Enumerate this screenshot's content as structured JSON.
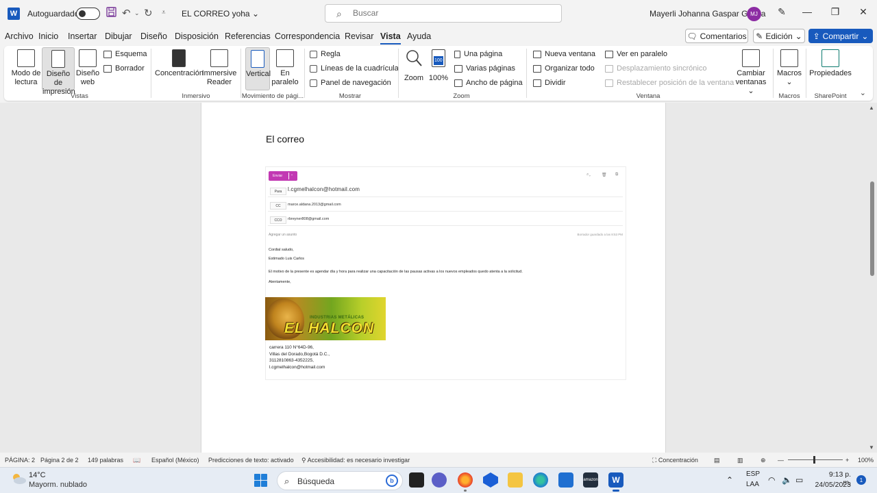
{
  "titlebar": {
    "autosave_label": "Autoguardado",
    "doc_title": "EL  CORREO yoha",
    "search_placeholder": "Buscar",
    "user_name": "Mayerli Johanna Gaspar Garcia",
    "user_initials": "MJ",
    "app_icon": "W"
  },
  "menu": {
    "items": [
      "Archivo",
      "Inicio",
      "Insertar",
      "Dibujar",
      "Diseño",
      "Disposición",
      "Referencias",
      "Correspondencia",
      "Revisar",
      "Vista",
      "Ayuda"
    ],
    "active": "Vista",
    "comments": "Comentarios",
    "edit": "Edición",
    "share": "Compartir"
  },
  "ribbon": {
    "vistas": {
      "label": "Vistas",
      "reading_1": "Modo de",
      "reading_2": "lectura",
      "print_1": "Diseño de",
      "print_2": "impresión",
      "web_1": "Diseño",
      "web_2": "web",
      "outline": "Esquema",
      "draft": "Borrador"
    },
    "inmersivo": {
      "label": "Inmersivo",
      "focus": "Concentración",
      "reader_1": "Immersive",
      "reader_2": "Reader"
    },
    "movimiento": {
      "label": "Movimiento de pági...",
      "vertical": "Vertical",
      "side_1": "En",
      "side_2": "paralelo"
    },
    "mostrar": {
      "label": "Mostrar",
      "ruler": "Regla",
      "gridlines": "Líneas de la cuadrícula",
      "navpane": "Panel de navegación"
    },
    "zoom": {
      "label": "Zoom",
      "zoom": "Zoom",
      "hundred": "100%",
      "hundred_icon": "100",
      "one_page": "Una página",
      "multi_page": "Varias páginas",
      "page_width": "Ancho de página"
    },
    "ventana": {
      "label": "Ventana",
      "new_window": "Nueva ventana",
      "arrange_all": "Organizar todo",
      "split": "Dividir",
      "side_by_side": "Ver en paralelo",
      "sync_scroll": "Desplazamiento sincrónico",
      "reset_pos": "Restablecer posición de la ventana",
      "switch_1": "Cambiar",
      "switch_2": "ventanas"
    },
    "macros": {
      "label": "Macros",
      "macros": "Macros"
    },
    "sharepoint": {
      "label": "SharePoint",
      "props": "Propiedades"
    }
  },
  "document": {
    "heading": "El correo",
    "email": {
      "send": "Enviar",
      "to_label": "Para",
      "to_value": "l.cgmelhalcon@hotmail.com",
      "cc_label": "CC",
      "cc_value": "marce.aldana.2013@gmail.com",
      "cco_label": "CCO",
      "cco_value": "rbreyner808@gmail.com",
      "subject_placeholder": "Agregar un asunto",
      "draft_saved": "Borrador guardado a las 8:53 PM",
      "greeting": "Cordial saludo,",
      "salutation": "Estimado Luis Carlos",
      "body": "El motivo de la presente es agendar día y hora para realizar una capacitación de las pausas activas a los nuevos empleados quedo atenta a la solicitud.",
      "closing": "Atentamente,",
      "banner_top": "INDUSTRIAS METÁLICAS",
      "banner_main": "EL HALCON",
      "address_1": "carrera 110 N°64D-96,",
      "address_2": "Villas del Dorado,Bogotá D.C.,",
      "address_3": "3112810863-4352225,",
      "address_4": "l.cgmelhalcon@hotmail.com"
    }
  },
  "statusbar": {
    "page_num": "PÁGINA: 2",
    "page_of": "Página 2 de 2",
    "words": "149 palabras",
    "language": "Español (México)",
    "predictions": "Predicciones de texto: activado",
    "accessibility": "Accesibilidad: es necesario investigar",
    "focus": "Concentración",
    "zoom": "100%",
    "zoom_level_percent": 100
  },
  "taskbar": {
    "temp": "14°C",
    "weather": "Mayorm. nublado",
    "search": "Búsqueda",
    "lang_1": "ESP",
    "lang_2": "LAA",
    "time": "9:13 p. m.",
    "date": "24/05/2023",
    "notifications": "1",
    "amazon_label": "amazon"
  }
}
